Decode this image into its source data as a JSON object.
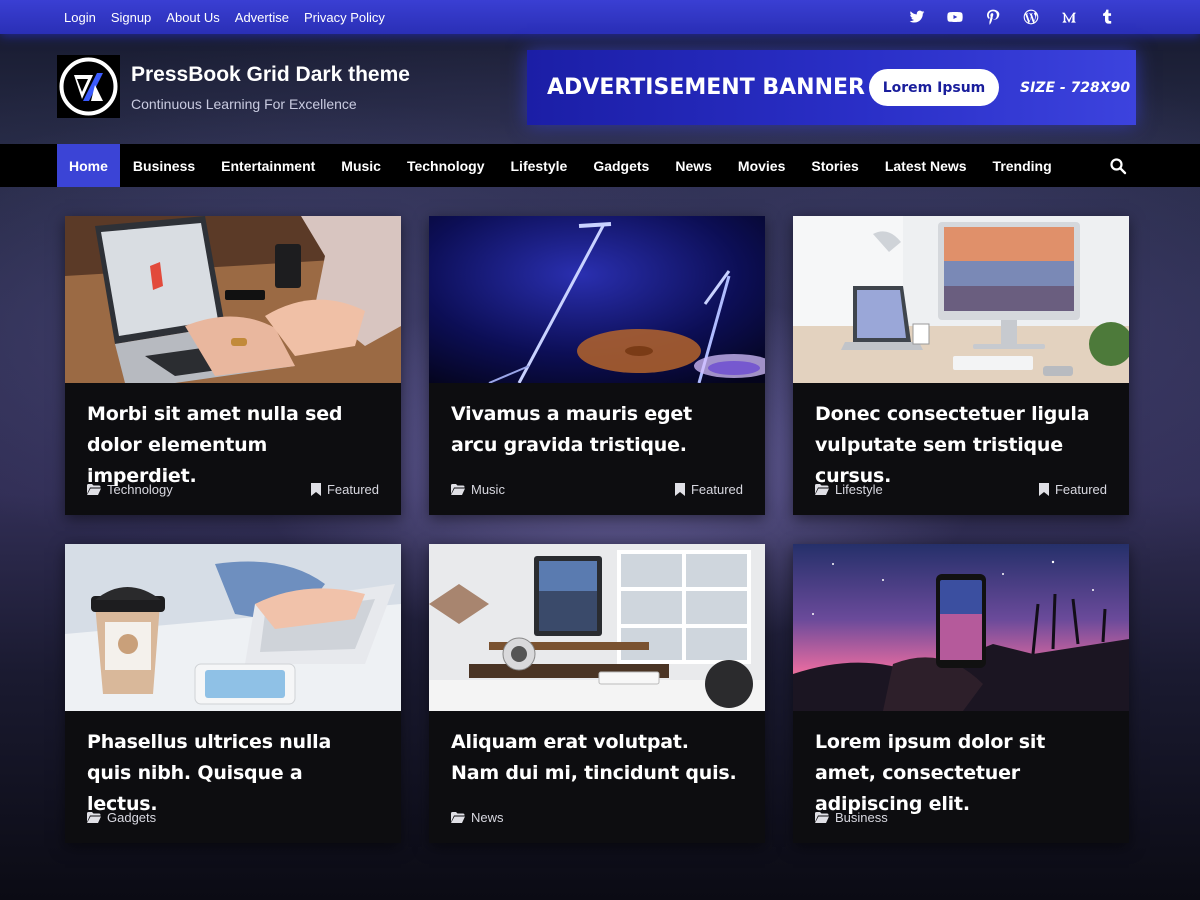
{
  "topbar": {
    "links": [
      "Login",
      "Signup",
      "About Us",
      "Advertise",
      "Privacy Policy"
    ],
    "social_icons": [
      "twitter-icon",
      "youtube-icon",
      "pinterest-icon",
      "wordpress-icon",
      "medium-icon",
      "tumblr-icon"
    ]
  },
  "header": {
    "site_title": "PressBook Grid Dark theme",
    "tagline": "Continuous Learning For Excellence"
  },
  "ad": {
    "title": "ADVERTISEMENT BANNER",
    "button": "Lorem Ipsum",
    "size": "SIZE - 728X90"
  },
  "nav": {
    "items": [
      "Home",
      "Business",
      "Entertainment",
      "Music",
      "Technology",
      "Lifestyle",
      "Gadgets",
      "News",
      "Movies",
      "Stories",
      "Latest News",
      "Trending"
    ],
    "active_item": "Home",
    "search_icon": "search-icon"
  },
  "posts": [
    {
      "title": "Morbi sit amet nulla sed dolor elementum imperdiet.",
      "category": "Technology",
      "featured": "Featured"
    },
    {
      "title": "Vivamus a mauris eget arcu gravida tristique.",
      "category": "Music",
      "featured": "Featured"
    },
    {
      "title": "Donec consectetuer ligula vulputate sem tristique cursus.",
      "category": "Lifestyle",
      "featured": "Featured"
    },
    {
      "title": "Phasellus ultrices nulla quis nibh. Quisque a lectus.",
      "category": "Gadgets"
    },
    {
      "title": "Aliquam erat volutpat. Nam dui mi, tincidunt quis.",
      "category": "News"
    },
    {
      "title": "Lorem ipsum dolor sit amet, consectetuer adipiscing elit.",
      "category": "Business"
    }
  ],
  "colors": {
    "accent": "#3b44d6",
    "topbar": "#2f34c4",
    "nav_background": "#000000",
    "card_background": "#0d0d10"
  }
}
